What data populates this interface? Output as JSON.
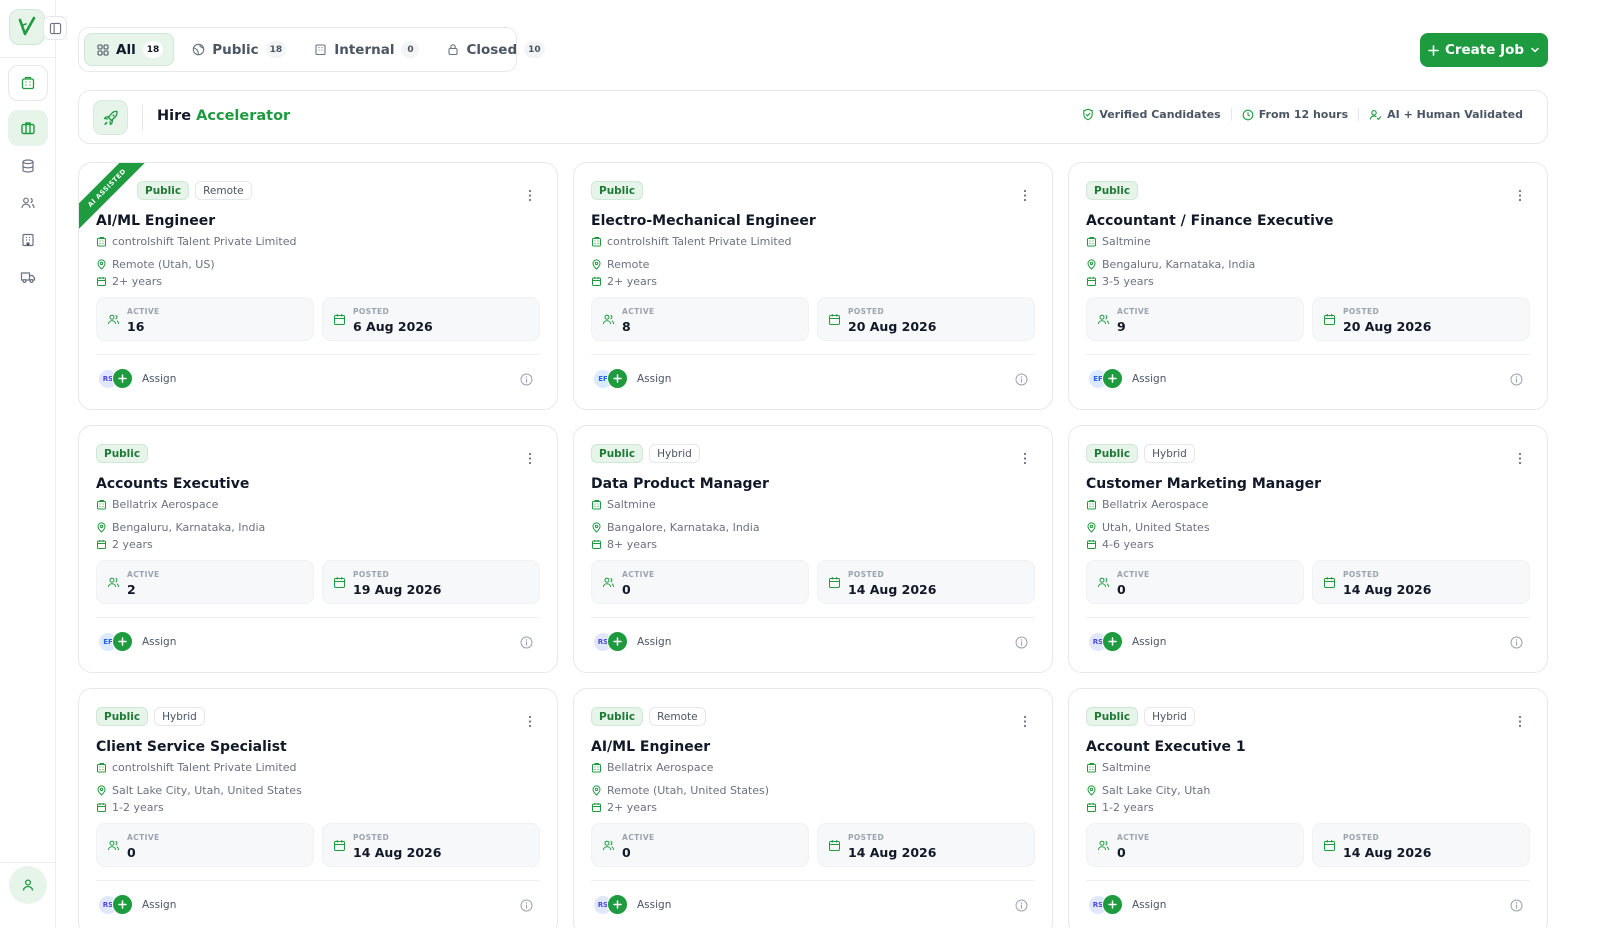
{
  "sidebar": {
    "logo_icon": "v-logo-icon",
    "items": [
      "building-icon",
      "briefcase-icon",
      "database-icon",
      "users-icon",
      "office-icon",
      "truck-icon"
    ],
    "active_item": "briefcase-icon",
    "profile_icon": "user-icon"
  },
  "tabs": [
    {
      "label": "All",
      "count": "18",
      "icon": "grid-icon",
      "active": true
    },
    {
      "label": "Public",
      "count": "18",
      "icon": "globe-icon",
      "active": false
    },
    {
      "label": "Internal",
      "count": "0",
      "icon": "building-icon",
      "active": false
    },
    {
      "label": "Closed",
      "count": "10",
      "icon": "lock-icon",
      "active": false
    }
  ],
  "create_button": {
    "label": "Create Job"
  },
  "accelerator": {
    "title_prefix": "Hire",
    "title_highlight": "Accelerator",
    "features": [
      "Verified Candidates",
      "From 12 hours",
      "AI + Human Validated"
    ]
  },
  "card_labels": {
    "active": "ACTIVE",
    "posted": "POSTED",
    "assign": "Assign"
  },
  "ribbon_text": "AI ASSISTED",
  "jobs": [
    {
      "title": "AI/ML Engineer",
      "company": "controlshift Talent Private Limited",
      "location": "Remote (Utah, US)",
      "experience": "2+ years",
      "active": "16",
      "posted": "6 Aug 2026",
      "badges": [
        "Public",
        "Remote"
      ],
      "avatar": "RS",
      "ai_assisted": true
    },
    {
      "title": "Electro-Mechanical Engineer",
      "company": "controlshift Talent Private Limited",
      "location": "Remote",
      "experience": "2+ years",
      "active": "8",
      "posted": "20 Aug 2026",
      "badges": [
        "Public"
      ],
      "avatar": "EF",
      "ai_assisted": false
    },
    {
      "title": "Accountant / Finance Executive",
      "company": "Saltmine",
      "location": "Bengaluru, Karnataka, India",
      "experience": "3-5 years",
      "active": "9",
      "posted": "20 Aug 2026",
      "badges": [
        "Public"
      ],
      "avatar": "EF",
      "ai_assisted": false
    },
    {
      "title": "Accounts Executive",
      "company": "Bellatrix Aerospace",
      "location": "Bengaluru, Karnataka, India",
      "experience": "2 years",
      "active": "2",
      "posted": "19 Aug 2026",
      "badges": [
        "Public"
      ],
      "avatar": "EF",
      "ai_assisted": false
    },
    {
      "title": "Data Product Manager",
      "company": "Saltmine",
      "location": "Bangalore, Karnataka, India",
      "experience": "8+ years",
      "active": "0",
      "posted": "14 Aug 2026",
      "badges": [
        "Public",
        "Hybrid"
      ],
      "avatar": "RS",
      "ai_assisted": false
    },
    {
      "title": "Customer Marketing Manager",
      "company": "Bellatrix Aerospace",
      "location": "Utah, United States",
      "experience": "4-6 years",
      "active": "0",
      "posted": "14 Aug 2026",
      "badges": [
        "Public",
        "Hybrid"
      ],
      "avatar": "RS",
      "ai_assisted": false
    },
    {
      "title": "Client Service Specialist",
      "company": "controlshift Talent Private Limited",
      "location": "Salt Lake City, Utah, United States",
      "experience": "1-2 years",
      "active": "0",
      "posted": "14 Aug 2026",
      "badges": [
        "Public",
        "Hybrid"
      ],
      "avatar": "RS",
      "ai_assisted": false
    },
    {
      "title": "AI/ML Engineer",
      "company": "Bellatrix Aerospace",
      "location": "Remote (Utah, United States)",
      "experience": "2+ years",
      "active": "0",
      "posted": "14 Aug 2026",
      "badges": [
        "Public",
        "Remote"
      ],
      "avatar": "RS",
      "ai_assisted": false
    },
    {
      "title": "Account Executive 1",
      "company": "Saltmine",
      "location": "Salt Lake City, Utah",
      "experience": "1-2 years",
      "active": "0",
      "posted": "14 Aug 2026",
      "badges": [
        "Public",
        "Hybrid"
      ],
      "avatar": "RS",
      "ai_assisted": false
    }
  ],
  "colors": {
    "accent": "#1e9b3f",
    "accent_light": "#e6f4ea",
    "border": "#e6e8eb"
  }
}
